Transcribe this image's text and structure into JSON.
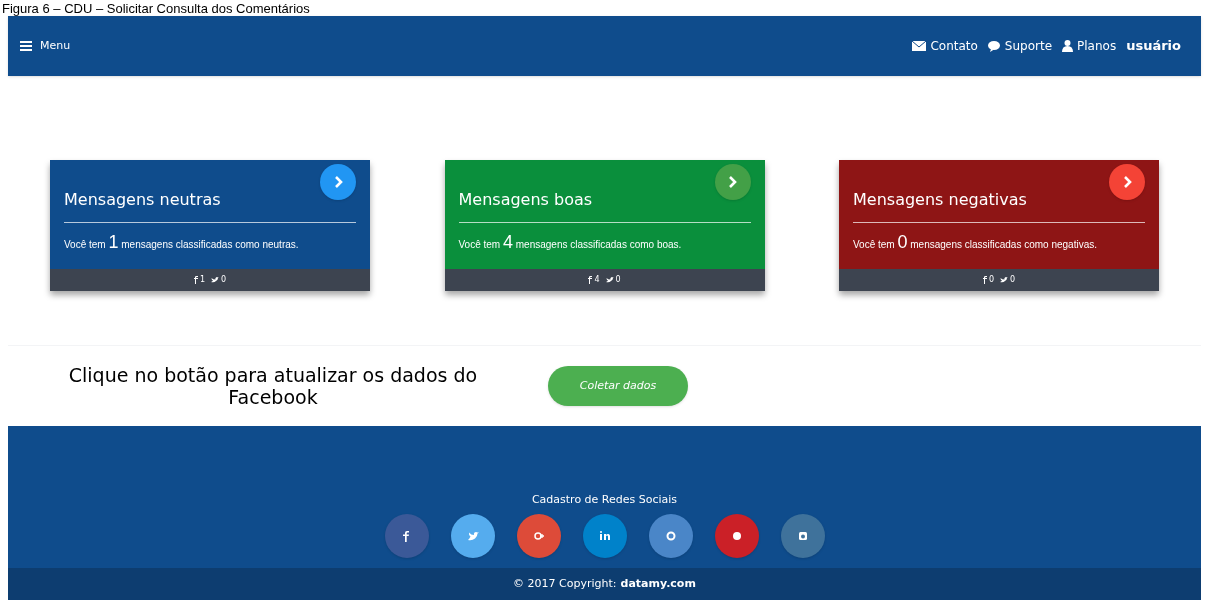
{
  "caption": "Figura 6 – CDU – Solicitar Consulta dos Comentários",
  "navbar": {
    "menu": "Menu",
    "links": [
      {
        "kind": "mail",
        "label": "Contato"
      },
      {
        "kind": "chat",
        "label": "Suporte"
      },
      {
        "kind": "user",
        "label": "Planos"
      }
    ],
    "user": "usuário"
  },
  "cards": [
    {
      "title": "Mensagens neutras",
      "color": "#0f4c8c",
      "button": {
        "color": "#2196f3"
      },
      "text_before": "Você tem",
      "count": "1",
      "text_after": "mensagens classificadas como neutras.",
      "facebook_count": "1",
      "twitter_count": "0"
    },
    {
      "title": "Mensagens boas",
      "color": "#0a8f3c",
      "button": {
        "color": "#43a047"
      },
      "text_before": "Você tem",
      "count": "4",
      "text_after": "mensagens classificadas como boas.",
      "facebook_count": "4",
      "twitter_count": "0"
    },
    {
      "title": "Mensagens negativas",
      "color": "#8e1515",
      "button": {
        "color": "#f44336"
      },
      "text_before": "Você tem",
      "count": "0",
      "text_after": "mensagens classificadas como negativas.",
      "facebook_count": "0",
      "twitter_count": "0"
    }
  ],
  "update": {
    "text": "Clique no botão para atualizar os dados do Facebook",
    "button": "Coletar dados"
  },
  "footer": {
    "title": "Cadastro de Redes Sociais",
    "socials": [
      {
        "kind": "f",
        "color": "#3b5998"
      },
      {
        "kind": "bird",
        "color": "#55acee"
      },
      {
        "kind": "gplus",
        "color": "#dd4b39"
      },
      {
        "kind": "in",
        "color": "#0082ca"
      },
      {
        "kind": "cat",
        "color": "#4a86c8"
      },
      {
        "kind": "dot",
        "color": "#cb2027"
      },
      {
        "kind": "square",
        "color": "#3f729b"
      }
    ],
    "copyright": "© 2017 Copyright:",
    "site": "datamy.com"
  }
}
